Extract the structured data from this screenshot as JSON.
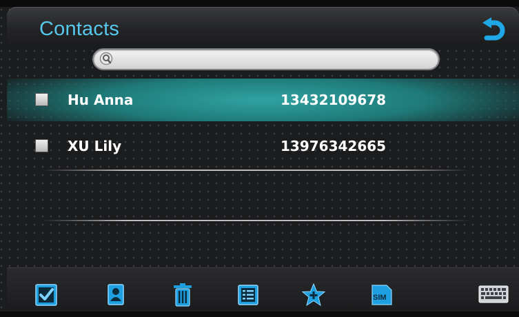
{
  "app": {
    "title": "Contacts"
  },
  "search": {
    "value": "",
    "placeholder": ""
  },
  "contacts": [
    {
      "name": "Hu Anna",
      "phone": "13432109678",
      "selected": true,
      "checked": false
    },
    {
      "name": "XU Lily",
      "phone": "13976342665",
      "selected": false,
      "checked": false
    }
  ],
  "toolbar": {
    "items": [
      {
        "icon": "check-all-icon"
      },
      {
        "icon": "contact-card-icon"
      },
      {
        "icon": "trash-icon"
      },
      {
        "icon": "list-icon"
      },
      {
        "icon": "favorite-star-icon"
      },
      {
        "icon": "sim-card-icon",
        "label": "SIM"
      },
      {
        "icon": "keyboard-icon"
      }
    ]
  },
  "colors": {
    "accent": "#57c7ec",
    "highlight": "#2fa3a1",
    "text": "#ffffff"
  }
}
